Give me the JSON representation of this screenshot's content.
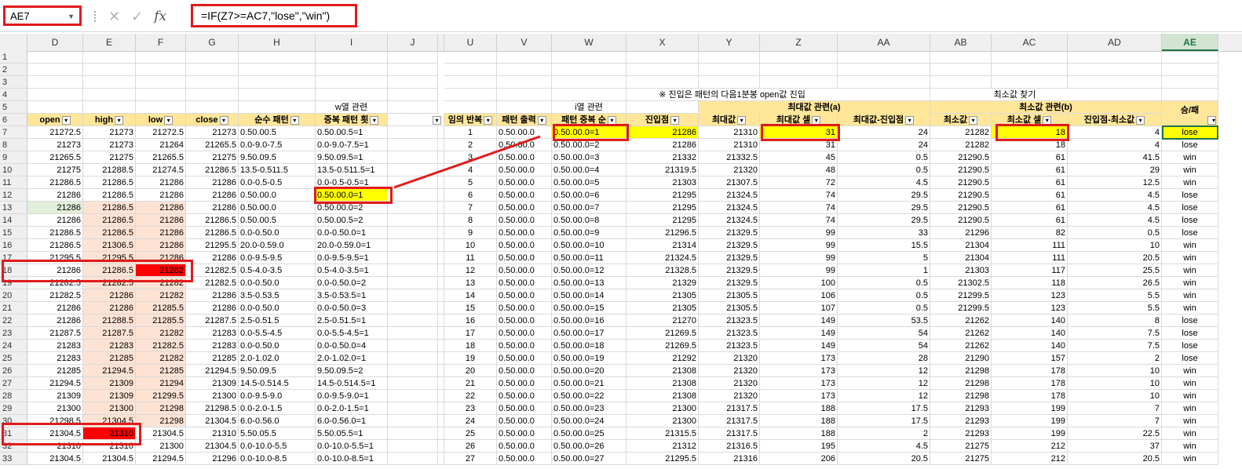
{
  "namebox": "AE7",
  "formula": "=IF(Z7>=AC7,\"lose\",\"win\")",
  "formula_icons": [
    "cancel-icon",
    "enter-icon",
    "fx-icon"
  ],
  "columns": [
    "D",
    "E",
    "F",
    "G",
    "H",
    "I",
    "J",
    "U",
    "V",
    "W",
    "X",
    "Y",
    "Z",
    "AA",
    "AB",
    "AC",
    "AD",
    "AE"
  ],
  "titles": {
    "w_related": "w열 관련",
    "i_related": "i열 관련",
    "entry_note": "※ 진입은 패턴의 다음1분봉 open값 진입",
    "min_find": "최소값 찾기",
    "max_group": "최대값 관련(a)",
    "min_group": "최소값 관련(b)",
    "win_lose": "승/패"
  },
  "headers": {
    "D": "open",
    "E": "high",
    "F": "low",
    "G": "close",
    "H": "순수 패턴",
    "I": "중복 패턴 횟",
    "U": "임의 반복",
    "V": "패턴 출력",
    "W": "패턴 중복 순",
    "X": "진입점",
    "Y": "최대값",
    "Z": "최대값 셀",
    "AA": "최대값-진입점",
    "AB": "최소값",
    "AC": "최소값 셀",
    "AD": "진입점-최소값"
  },
  "rows": [
    {
      "n": "7",
      "D": "21272.5",
      "E": "21273",
      "F": "21272.5",
      "G": "21273",
      "H": "0.50.00.5",
      "I": "0.50.00.5=1",
      "U": "1",
      "V": "0.50.00.0",
      "W": "0.50.00.0=1",
      "X": "21286",
      "Y": "21310",
      "Z": "31",
      "AA": "24",
      "AB": "21282",
      "AC": "18",
      "AD": "4",
      "AE": "lose"
    },
    {
      "n": "8",
      "D": "21273",
      "E": "21273",
      "F": "21264",
      "G": "21265.5",
      "H": "0.0-9.0-7.5",
      "I": "0.0-9.0-7.5=1",
      "U": "2",
      "V": "0.50.00.0",
      "W": "0.50.00.0=2",
      "X": "21286",
      "Y": "21310",
      "Z": "31",
      "AA": "24",
      "AB": "21282",
      "AC": "18",
      "AD": "4",
      "AE": "lose"
    },
    {
      "n": "9",
      "D": "21265.5",
      "E": "21275",
      "F": "21265.5",
      "G": "21275",
      "H": "9.50.09.5",
      "I": "9.50.09.5=1",
      "U": "3",
      "V": "0.50.00.0",
      "W": "0.50.00.0=3",
      "X": "21332",
      "Y": "21332.5",
      "Z": "45",
      "AA": "0.5",
      "AB": "21290.5",
      "AC": "61",
      "AD": "41.5",
      "AE": "win"
    },
    {
      "n": "10",
      "D": "21275",
      "E": "21288.5",
      "F": "21274.5",
      "G": "21286.5",
      "H": "13.5-0.511.5",
      "I": "13.5-0.511.5=1",
      "U": "4",
      "V": "0.50.00.0",
      "W": "0.50.00.0=4",
      "X": "21319.5",
      "Y": "21320",
      "Z": "48",
      "AA": "0.5",
      "AB": "21290.5",
      "AC": "61",
      "AD": "29",
      "AE": "win"
    },
    {
      "n": "11",
      "D": "21286.5",
      "E": "21286.5",
      "F": "21286",
      "G": "21286",
      "H": "0.0-0.5-0.5",
      "I": "0.0-0.5-0.5=1",
      "U": "5",
      "V": "0.50.00.0",
      "W": "0.50.00.0=5",
      "X": "21303",
      "Y": "21307.5",
      "Z": "72",
      "AA": "4.5",
      "AB": "21290.5",
      "AC": "61",
      "AD": "12.5",
      "AE": "win"
    },
    {
      "n": "12",
      "D": "21286",
      "E": "21286.5",
      "F": "21286",
      "G": "21286",
      "H": "0.50.00.0",
      "I": "0.50.00.0=1",
      "U": "6",
      "V": "0.50.00.0",
      "W": "0.50.00.0=6",
      "X": "21295",
      "Y": "21324.5",
      "Z": "74",
      "AA": "29.5",
      "AB": "21290.5",
      "AC": "61",
      "AD": "4.5",
      "AE": "lose"
    },
    {
      "n": "13",
      "D": "21286",
      "E": "21286.5",
      "F": "21286",
      "G": "21286",
      "H": "0.50.00.0",
      "I": "0.50.00.0=2",
      "U": "7",
      "V": "0.50.00.0",
      "W": "0.50.00.0=7",
      "X": "21295",
      "Y": "21324.5",
      "Z": "74",
      "AA": "29.5",
      "AB": "21290.5",
      "AC": "61",
      "AD": "4.5",
      "AE": "lose"
    },
    {
      "n": "14",
      "D": "21286",
      "E": "21286.5",
      "F": "21286",
      "G": "21286.5",
      "H": "0.50.00.5",
      "I": "0.50.00.5=2",
      "U": "8",
      "V": "0.50.00.0",
      "W": "0.50.00.0=8",
      "X": "21295",
      "Y": "21324.5",
      "Z": "74",
      "AA": "29.5",
      "AB": "21290.5",
      "AC": "61",
      "AD": "4.5",
      "AE": "lose"
    },
    {
      "n": "15",
      "D": "21286.5",
      "E": "21286.5",
      "F": "21286",
      "G": "21286.5",
      "H": "0.0-0.50.0",
      "I": "0.0-0.50.0=1",
      "U": "9",
      "V": "0.50.00.0",
      "W": "0.50.00.0=9",
      "X": "21296.5",
      "Y": "21329.5",
      "Z": "99",
      "AA": "33",
      "AB": "21296",
      "AC": "82",
      "AD": "0.5",
      "AE": "lose"
    },
    {
      "n": "16",
      "D": "21286.5",
      "E": "21306.5",
      "F": "21286",
      "G": "21295.5",
      "H": "20.0-0.59.0",
      "I": "20.0-0.59.0=1",
      "U": "10",
      "V": "0.50.00.0",
      "W": "0.50.00.0=10",
      "X": "21314",
      "Y": "21329.5",
      "Z": "99",
      "AA": "15.5",
      "AB": "21304",
      "AC": "111",
      "AD": "10",
      "AE": "win"
    },
    {
      "n": "17",
      "D": "21295.5",
      "E": "21295.5",
      "F": "21286",
      "G": "21286",
      "H": "0.0-9.5-9.5",
      "I": "0.0-9.5-9.5=1",
      "U": "11",
      "V": "0.50.00.0",
      "W": "0.50.00.0=11",
      "X": "21324.5",
      "Y": "21329.5",
      "Z": "99",
      "AA": "5",
      "AB": "21304",
      "AC": "111",
      "AD": "20.5",
      "AE": "win"
    },
    {
      "n": "18",
      "D": "21286",
      "E": "21286.5",
      "F": "21282",
      "G": "21282.5",
      "H": "0.5-4.0-3.5",
      "I": "0.5-4.0-3.5=1",
      "U": "12",
      "V": "0.50.00.0",
      "W": "0.50.00.0=12",
      "X": "21328.5",
      "Y": "21329.5",
      "Z": "99",
      "AA": "1",
      "AB": "21303",
      "AC": "117",
      "AD": "25.5",
      "AE": "win"
    },
    {
      "n": "19",
      "D": "21282.5",
      "E": "21282.5",
      "F": "21282",
      "G": "21282.5",
      "H": "0.0-0.50.0",
      "I": "0.0-0.50.0=2",
      "U": "13",
      "V": "0.50.00.0",
      "W": "0.50.00.0=13",
      "X": "21329",
      "Y": "21329.5",
      "Z": "100",
      "AA": "0.5",
      "AB": "21302.5",
      "AC": "118",
      "AD": "26.5",
      "AE": "win"
    },
    {
      "n": "20",
      "D": "21282.5",
      "E": "21286",
      "F": "21282",
      "G": "21286",
      "H": "3.5-0.53.5",
      "I": "3.5-0.53.5=1",
      "U": "14",
      "V": "0.50.00.0",
      "W": "0.50.00.0=14",
      "X": "21305",
      "Y": "21305.5",
      "Z": "106",
      "AA": "0.5",
      "AB": "21299.5",
      "AC": "123",
      "AD": "5.5",
      "AE": "win"
    },
    {
      "n": "21",
      "D": "21286",
      "E": "21286",
      "F": "21285.5",
      "G": "21286",
      "H": "0.0-0.50.0",
      "I": "0.0-0.50.0=3",
      "U": "15",
      "V": "0.50.00.0",
      "W": "0.50.00.0=15",
      "X": "21305",
      "Y": "21305.5",
      "Z": "107",
      "AA": "0.5",
      "AB": "21299.5",
      "AC": "123",
      "AD": "5.5",
      "AE": "win"
    },
    {
      "n": "22",
      "D": "21286",
      "E": "21288.5",
      "F": "21285.5",
      "G": "21287.5",
      "H": "2.5-0.51.5",
      "I": "2.5-0.51.5=1",
      "U": "16",
      "V": "0.50.00.0",
      "W": "0.50.00.0=16",
      "X": "21270",
      "Y": "21323.5",
      "Z": "149",
      "AA": "53.5",
      "AB": "21262",
      "AC": "140",
      "AD": "8",
      "AE": "lose"
    },
    {
      "n": "23",
      "D": "21287.5",
      "E": "21287.5",
      "F": "21282",
      "G": "21283",
      "H": "0.0-5.5-4.5",
      "I": "0.0-5.5-4.5=1",
      "U": "17",
      "V": "0.50.00.0",
      "W": "0.50.00.0=17",
      "X": "21269.5",
      "Y": "21323.5",
      "Z": "149",
      "AA": "54",
      "AB": "21262",
      "AC": "140",
      "AD": "7.5",
      "AE": "lose"
    },
    {
      "n": "24",
      "D": "21283",
      "E": "21283",
      "F": "21282.5",
      "G": "21283",
      "H": "0.0-0.50.0",
      "I": "0.0-0.50.0=4",
      "U": "18",
      "V": "0.50.00.0",
      "W": "0.50.00.0=18",
      "X": "21269.5",
      "Y": "21323.5",
      "Z": "149",
      "AA": "54",
      "AB": "21262",
      "AC": "140",
      "AD": "7.5",
      "AE": "lose"
    },
    {
      "n": "25",
      "D": "21283",
      "E": "21285",
      "F": "21282",
      "G": "21285",
      "H": "2.0-1.02.0",
      "I": "2.0-1.02.0=1",
      "U": "19",
      "V": "0.50.00.0",
      "W": "0.50.00.0=19",
      "X": "21292",
      "Y": "21320",
      "Z": "173",
      "AA": "28",
      "AB": "21290",
      "AC": "157",
      "AD": "2",
      "AE": "lose"
    },
    {
      "n": "26",
      "D": "21285",
      "E": "21294.5",
      "F": "21285",
      "G": "21294.5",
      "H": "9.50.09.5",
      "I": "9.50.09.5=2",
      "U": "20",
      "V": "0.50.00.0",
      "W": "0.50.00.0=20",
      "X": "21308",
      "Y": "21320",
      "Z": "173",
      "AA": "12",
      "AB": "21298",
      "AC": "178",
      "AD": "10",
      "AE": "win"
    },
    {
      "n": "27",
      "D": "21294.5",
      "E": "21309",
      "F": "21294",
      "G": "21309",
      "H": "14.5-0.514.5",
      "I": "14.5-0.514.5=1",
      "U": "21",
      "V": "0.50.00.0",
      "W": "0.50.00.0=21",
      "X": "21308",
      "Y": "21320",
      "Z": "173",
      "AA": "12",
      "AB": "21298",
      "AC": "178",
      "AD": "10",
      "AE": "win"
    },
    {
      "n": "28",
      "D": "21309",
      "E": "21309",
      "F": "21299.5",
      "G": "21300",
      "H": "0.0-9.5-9.0",
      "I": "0.0-9.5-9.0=1",
      "U": "22",
      "V": "0.50.00.0",
      "W": "0.50.00.0=22",
      "X": "21308",
      "Y": "21320",
      "Z": "173",
      "AA": "12",
      "AB": "21298",
      "AC": "178",
      "AD": "10",
      "AE": "win"
    },
    {
      "n": "29",
      "D": "21300",
      "E": "21300",
      "F": "21298",
      "G": "21298.5",
      "H": "0.0-2.0-1.5",
      "I": "0.0-2.0-1.5=1",
      "U": "23",
      "V": "0.50.00.0",
      "W": "0.50.00.0=23",
      "X": "21300",
      "Y": "21317.5",
      "Z": "188",
      "AA": "17.5",
      "AB": "21293",
      "AC": "199",
      "AD": "7",
      "AE": "win"
    },
    {
      "n": "30",
      "D": "21298.5",
      "E": "21304.5",
      "F": "21298",
      "G": "21304.5",
      "H": "6.0-0.56.0",
      "I": "6.0-0.56.0=1",
      "U": "24",
      "V": "0.50.00.0",
      "W": "0.50.00.0=24",
      "X": "21300",
      "Y": "21317.5",
      "Z": "188",
      "AA": "17.5",
      "AB": "21293",
      "AC": "199",
      "AD": "7",
      "AE": "win"
    },
    {
      "n": "31",
      "D": "21304.5",
      "E": "21310",
      "F": "21304.5",
      "G": "21310",
      "H": "5.50.05.5",
      "I": "5.50.05.5=1",
      "U": "25",
      "V": "0.50.00.0",
      "W": "0.50.00.0=25",
      "X": "21315.5",
      "Y": "21317.5",
      "Z": "188",
      "AA": "2",
      "AB": "21293",
      "AC": "199",
      "AD": "22.5",
      "AE": "win"
    },
    {
      "n": "32",
      "D": "21310",
      "E": "21310",
      "F": "21300",
      "G": "21304.5",
      "H": "0.0-10.0-5.5",
      "I": "0.0-10.0-5.5=1",
      "U": "26",
      "V": "0.50.00.0",
      "W": "0.50.00.0=26",
      "X": "21312",
      "Y": "21316.5",
      "Z": "195",
      "AA": "4.5",
      "AB": "21275",
      "AC": "212",
      "AD": "37",
      "AE": "win"
    },
    {
      "n": "33",
      "D": "21304.5",
      "E": "21304.5",
      "F": "21294.5",
      "G": "21296",
      "H": "0.0-10.0-8.5",
      "I": "0.0-10.0-8.5=1",
      "U": "27",
      "V": "0.50.00.0",
      "W": "0.50.00.0=27",
      "X": "21295.5",
      "Y": "21316",
      "Z": "206",
      "AA": "20.5",
      "AB": "21275",
      "AC": "212",
      "AD": "20.5",
      "AE": "win"
    }
  ],
  "colors": {
    "header_fill": "#ffe699",
    "highlight_yellow": "#ffff00",
    "highlight_red": "#ff0000",
    "peach": "#fde3d4",
    "green": "#e2efda",
    "annotation_red": "#e01b1b"
  }
}
